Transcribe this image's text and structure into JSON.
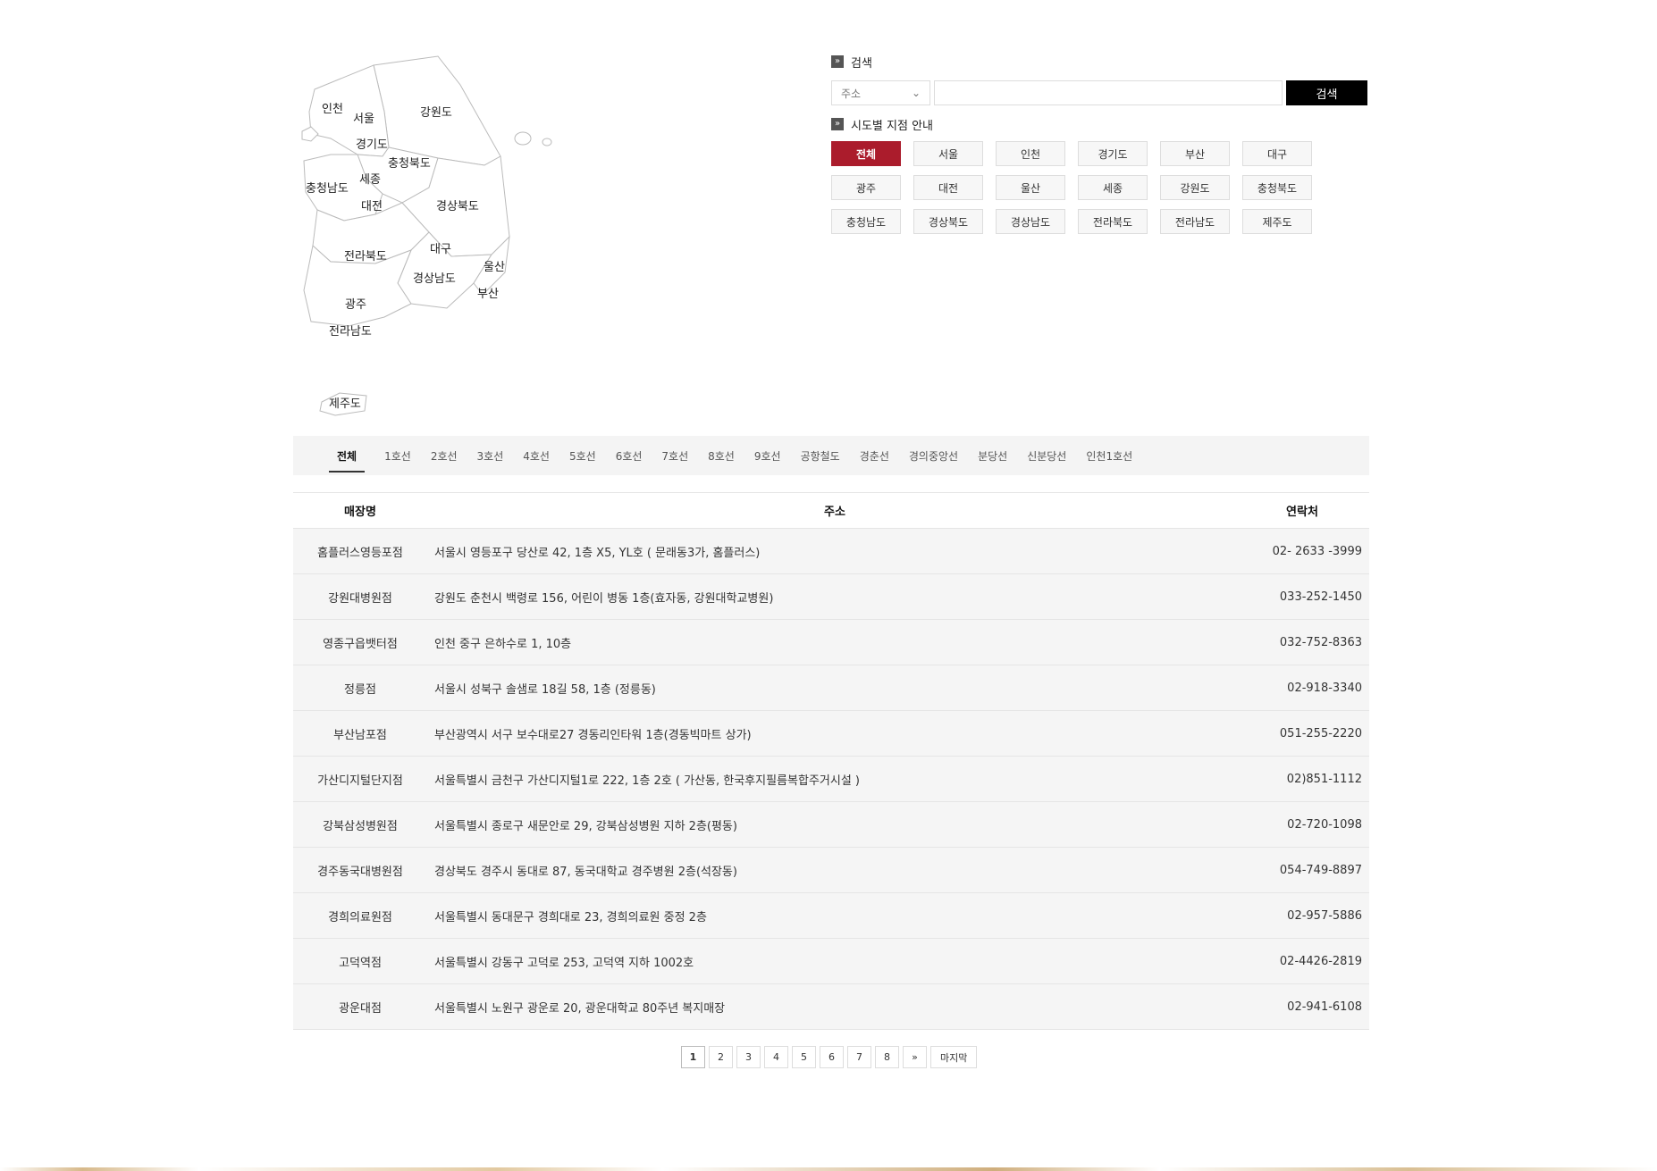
{
  "map": {
    "regions": [
      "인천",
      "서울",
      "강원도",
      "경기도",
      "충청북도",
      "충청남도",
      "세종",
      "대전",
      "경상북도",
      "전라북도",
      "대구",
      "울산",
      "경상남도",
      "부산",
      "광주",
      "전라남도",
      "제주도"
    ]
  },
  "search": {
    "title": "검색",
    "select_value": "주소",
    "input_value": "",
    "button_label": "검색"
  },
  "sido": {
    "title": "시도별 지점 안내",
    "buttons": [
      "전체",
      "서울",
      "인천",
      "경기도",
      "부산",
      "대구",
      "광주",
      "대전",
      "울산",
      "세종",
      "강원도",
      "충청북도",
      "충청남도",
      "경상북도",
      "경상남도",
      "전라북도",
      "전라남도",
      "제주도"
    ],
    "active": "전체"
  },
  "lines": {
    "tabs": [
      "전체",
      "1호선",
      "2호선",
      "3호선",
      "4호선",
      "5호선",
      "6호선",
      "7호선",
      "8호선",
      "9호선",
      "공항철도",
      "경춘선",
      "경의중앙선",
      "분당선",
      "신분당선",
      "인천1호선"
    ],
    "active": "전체"
  },
  "table": {
    "headers": {
      "name": "매장명",
      "address": "주소",
      "phone": "연락처"
    },
    "rows": [
      {
        "name": "홈플러스영등포점",
        "address": "서울시 영등포구 당산로 42, 1층 X5, YL호 ( 문래동3가, 홈플러스)",
        "phone": "02- 2633 -3999"
      },
      {
        "name": "강원대병원점",
        "address": "강원도 춘천시 백령로 156, 어린이 병동 1층(효자동, 강원대학교병원)",
        "phone": "033-252-1450"
      },
      {
        "name": "영종구읍뱃터점",
        "address": "인천 중구 은하수로 1, 10층",
        "phone": "032-752-8363"
      },
      {
        "name": "정릉점",
        "address": "서울시 성북구 솔샘로 18길 58, 1층 (정릉동)",
        "phone": "02-918-3340"
      },
      {
        "name": "부산남포점",
        "address": "부산광역시 서구 보수대로27 경동리인타워 1층(경동빅마트 상가)",
        "phone": "051-255-2220"
      },
      {
        "name": "가산디지털단지점",
        "address": "서울특별시 금천구 가산디지털1로 222, 1층 2호 ( 가산동, 한국후지필름복합주거시설 )",
        "phone": "02)851-1112"
      },
      {
        "name": "강북삼성병원점",
        "address": "서울특별시 종로구 새문안로 29, 강북삼성병원 지하 2층(평동)",
        "phone": "02-720-1098"
      },
      {
        "name": "경주동국대병원점",
        "address": "경상북도 경주시 동대로 87, 동국대학교 경주병원 2층(석장동)",
        "phone": "054-749-8897"
      },
      {
        "name": "경희의료원점",
        "address": "서울특별시 동대문구 경희대로 23, 경희의료원 중정 2층",
        "phone": "02-957-5886"
      },
      {
        "name": "고덕역점",
        "address": "서울특별시 강동구 고덕로 253, 고덕역 지하 1002호",
        "phone": "02-4426-2819"
      },
      {
        "name": "광운대점",
        "address": "서울특별시 노원구 광운로 20, 광운대학교 80주년 복지매장",
        "phone": "02-941-6108"
      }
    ]
  },
  "pagination": {
    "pages": [
      "1",
      "2",
      "3",
      "4",
      "5",
      "6",
      "7",
      "8"
    ],
    "current": "1",
    "next_label": "»",
    "last_label": "마지막"
  },
  "colors": {
    "accent": "#ab1c2c",
    "search_button": "#000000"
  }
}
